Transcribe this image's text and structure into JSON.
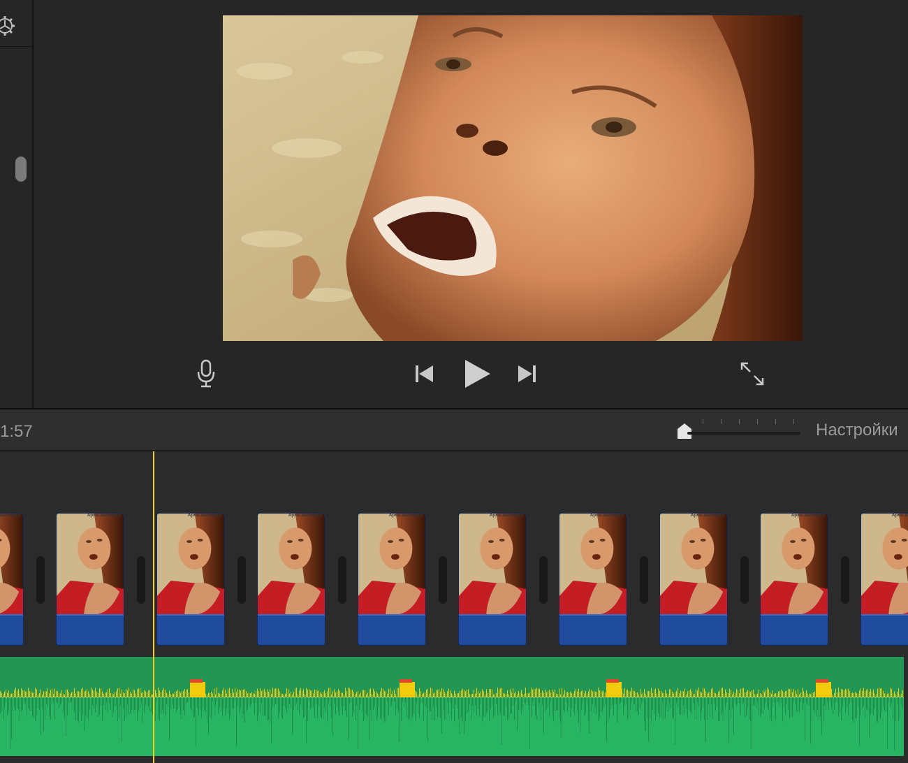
{
  "sidebar": {
    "settings_icon": "gear-icon",
    "scroll_indicator": "scroll-thumb"
  },
  "viewer": {
    "controls": {
      "voiceover_icon": "microphone-icon",
      "previous_icon": "skip-back-icon",
      "play_icon": "play-icon",
      "next_icon": "skip-forward-icon",
      "fullscreen_icon": "fullscreen-icon"
    }
  },
  "toolbar": {
    "timecode": "1:57",
    "settings_label": "Настройки",
    "zoom_level": 0
  },
  "timeline": {
    "clip_caption": "Архів Володими",
    "clips": [
      {
        "name": "clip-1"
      },
      {
        "name": "clip-2"
      },
      {
        "name": "clip-3"
      },
      {
        "name": "clip-4"
      },
      {
        "name": "clip-5"
      },
      {
        "name": "clip-6"
      },
      {
        "name": "clip-7"
      },
      {
        "name": "clip-8"
      },
      {
        "name": "clip-9"
      },
      {
        "name": "clip-10"
      }
    ],
    "colors": {
      "video_clip": "#1f4b9c",
      "audio_track": "#27b463",
      "audio_peak": "#f2cc0c",
      "audio_clip": "#e2452b",
      "playhead": "#f5d020"
    }
  }
}
